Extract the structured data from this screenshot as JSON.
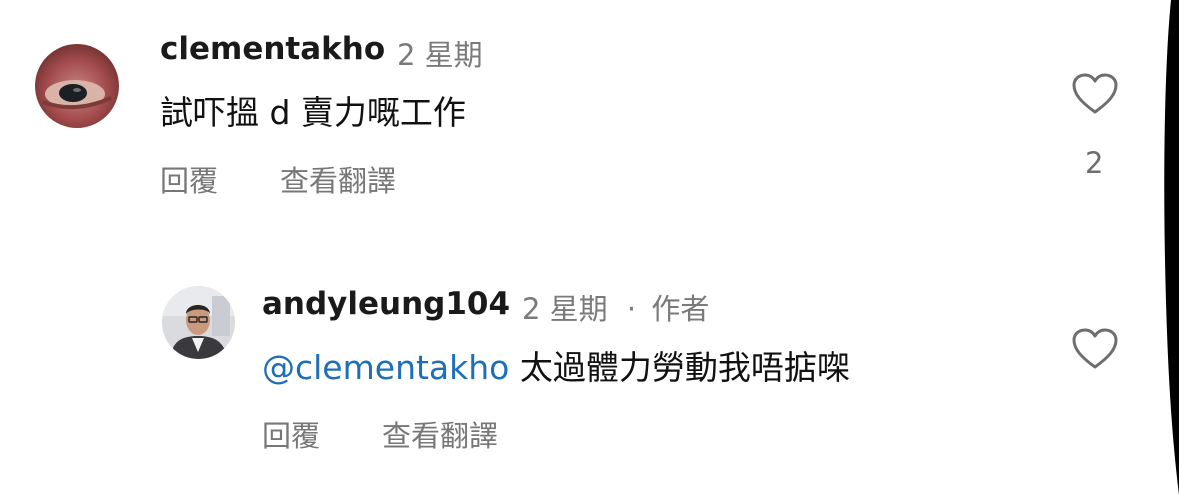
{
  "comments": [
    {
      "username": "clementakho",
      "time": "2 星期",
      "text": "試吓搵 d 賣力嘅工作",
      "reply_label": "回覆",
      "translate_label": "查看翻譯",
      "like_count": "2",
      "avatar_icon": "eye-closeup-avatar"
    },
    {
      "username": "andyleung104",
      "time": "2 星期",
      "separator": "·",
      "author_badge": "作者",
      "mention": "@clementakho",
      "text": "太過體力勞動我唔掂㗎",
      "reply_label": "回覆",
      "translate_label": "查看翻譯",
      "avatar_icon": "person-photo-avatar"
    }
  ],
  "colors": {
    "mention": "#1f6fb8",
    "meta": "#7a7a7a",
    "action": "#777777",
    "edge": "#000000"
  }
}
